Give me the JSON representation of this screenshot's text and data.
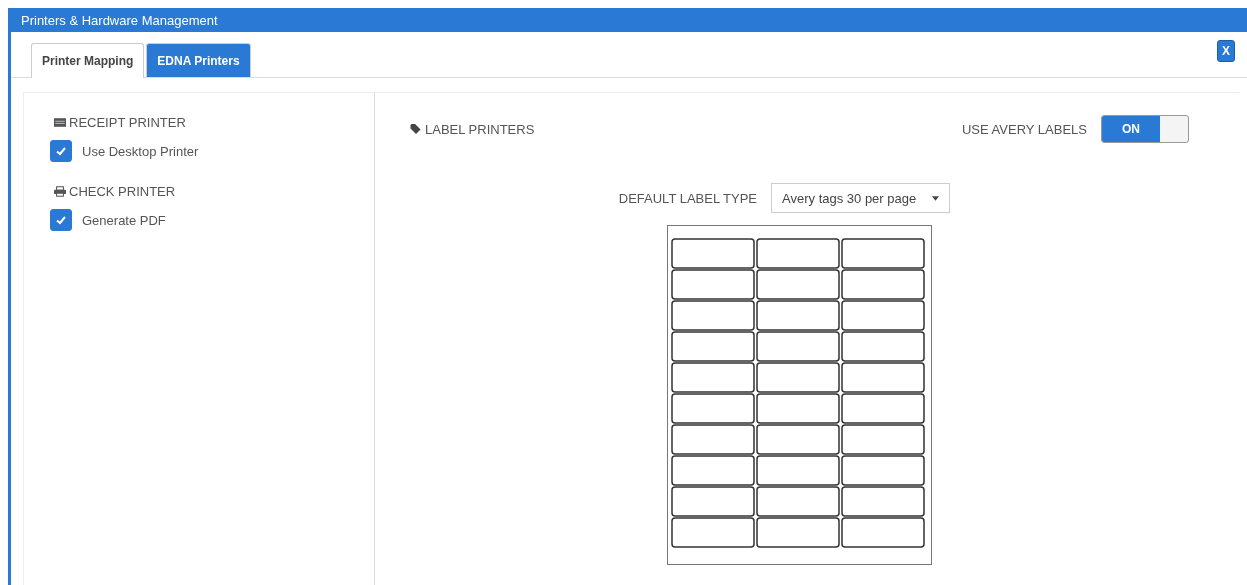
{
  "window": {
    "title": "Printers & Hardware Management",
    "close": "X"
  },
  "tabs": [
    {
      "label": "Printer Mapping",
      "selected": true
    },
    {
      "label": "EDNA Printers",
      "selected": false
    }
  ],
  "sections": [
    {
      "kind": "receipt",
      "heading": "RECEIPT PRINTER",
      "option": {
        "label": "Use Desktop Printer",
        "checked": true
      }
    },
    {
      "kind": "check",
      "heading": "CHECK PRINTER",
      "option": {
        "label": "Generate PDF",
        "checked": true
      }
    }
  ],
  "label_printers": {
    "heading": "LABEL PRINTERS",
    "avery": {
      "label": "USE AVERY LABELS",
      "on": true,
      "text": "ON"
    },
    "default_type": {
      "label": "DEFAULT LABEL TYPE",
      "value": "Avery tags 30 per page"
    }
  }
}
